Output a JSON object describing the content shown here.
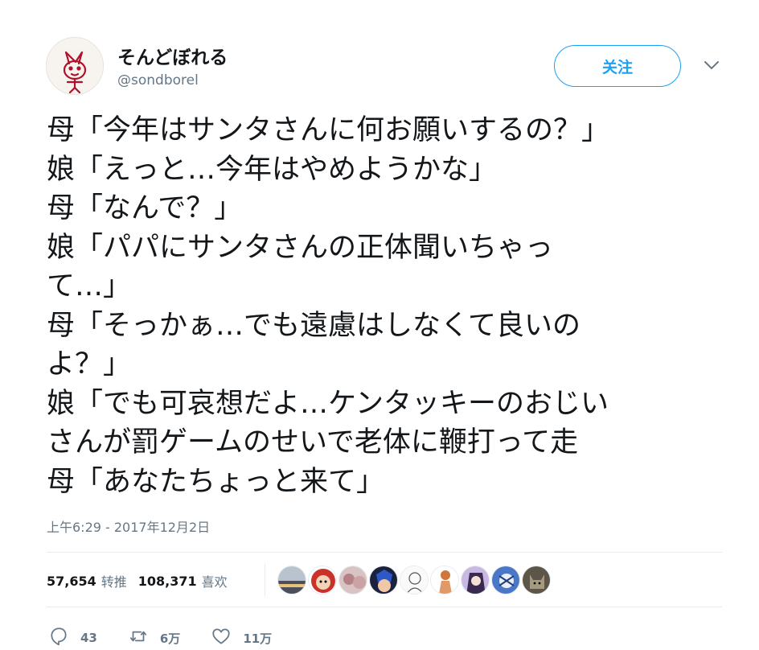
{
  "author": {
    "display_name": "そんどぼれる",
    "handle": "@sondborel",
    "avatar_icon": "fox-drawing-avatar-icon"
  },
  "follow_button": {
    "label": "关注",
    "color": "#1da1f2"
  },
  "menu": {
    "icon": "chevron-down-icon"
  },
  "tweet": {
    "lines": [
      "母「今年はサンタさんに何お願いするの？」",
      "娘「えっと…今年はやめようかな」",
      "母「なんで？」",
      "娘「パパにサンタさんの正体聞いちゃっ",
      "て…」",
      "母「そっかぁ…でも遠慮はしなくて良いの",
      "よ？」",
      "娘「でも可哀想だよ…ケンタッキーのおじい",
      "さんが罰ゲームのせいで老体に鞭打って走",
      "母「あなたちょっと来て」"
    ]
  },
  "timestamp": "上午6:29 - 2017年12月2日",
  "stats": {
    "retweets_count": "57,654",
    "retweets_label": "转推",
    "likes_count": "108,371",
    "likes_label": "喜欢"
  },
  "liker_avatars": [
    {
      "name": "liker-avatar-landscape",
      "color": "#6b6f7a"
    },
    {
      "name": "liker-avatar-red-character",
      "color": "#c8322a"
    },
    {
      "name": "liker-avatar-pink-blur",
      "color": "#c9a3a6"
    },
    {
      "name": "liker-avatar-blue-character",
      "color": "#2a3f86"
    },
    {
      "name": "liker-avatar-sketch",
      "color": "#d8d8d8"
    },
    {
      "name": "liker-avatar-orange-figure",
      "color": "#d0753c"
    },
    {
      "name": "liker-avatar-purple-anime",
      "color": "#8b6fb3"
    },
    {
      "name": "liker-avatar-blue-white",
      "color": "#4a78c8"
    },
    {
      "name": "liker-avatar-cat",
      "color": "#8a8066"
    }
  ],
  "actions": {
    "reply_icon": "reply-icon",
    "reply_count": "43",
    "retweet_icon": "retweet-icon",
    "retweet_count": "6万",
    "like_icon": "heart-icon",
    "like_count": "11万"
  }
}
